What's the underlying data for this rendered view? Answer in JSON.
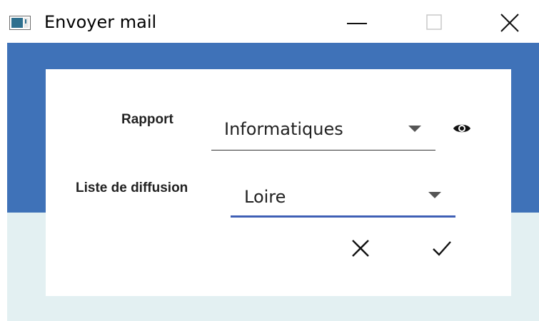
{
  "window": {
    "title": "Envoyer mail"
  },
  "form": {
    "rapport": {
      "label": "Rapport",
      "value": "Informatiques"
    },
    "liste_diffusion": {
      "label": "Liste de diffusion",
      "value": "Loire"
    }
  },
  "icons": {
    "app": "app-window-icon",
    "minimize": "minimize-icon",
    "maximize": "maximize-icon",
    "close": "close-icon",
    "preview": "eye-icon",
    "cancel": "x-icon",
    "confirm": "checkmark-icon"
  },
  "colors": {
    "header_blue": "#3f72b8",
    "lower_band": "#e3f0f2",
    "active_underline": "#3f5fb5",
    "card": "#ffffff"
  }
}
